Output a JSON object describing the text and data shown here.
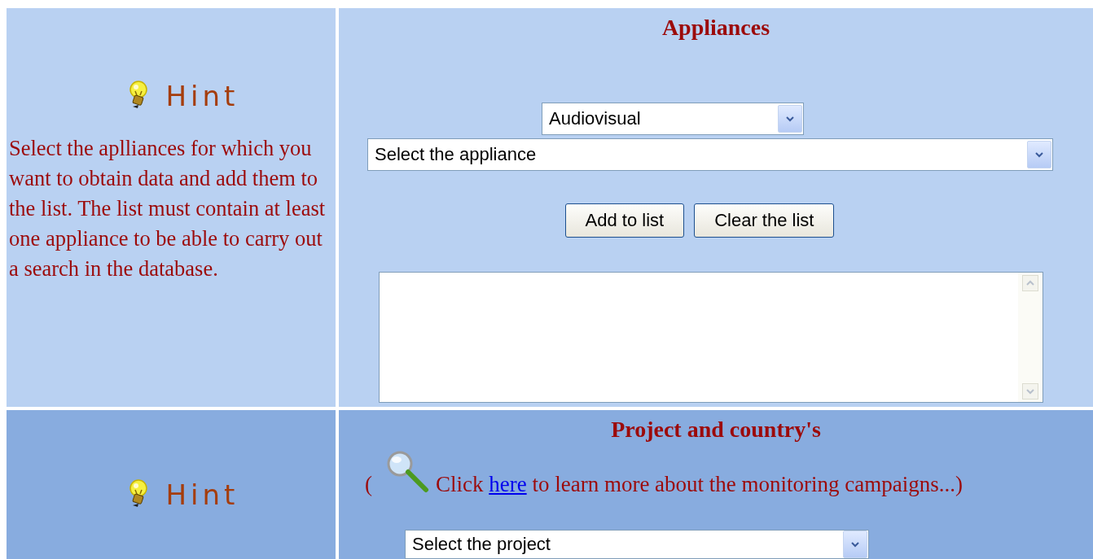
{
  "sections": [
    {
      "hint": {
        "label": "Hint",
        "text": "Select the aplliances for which you want to obtain data and add them to the list. The list must contain at least one appliance to be able to carry out a search in the database."
      },
      "title": "Appliances",
      "controls": [
        {
          "kind": "select",
          "value": "Audiovisual"
        },
        {
          "kind": "select",
          "value": "Select the appliance"
        },
        {
          "kind": "buttons",
          "buttons": [
            "Add to list",
            "Clear the list"
          ]
        },
        {
          "kind": "listbox"
        }
      ]
    },
    {
      "hint": {
        "label": "Hint"
      },
      "title": "Project and country's",
      "controls": [
        {
          "kind": "info",
          "open": "(",
          "before": "Click ",
          "link": "here",
          "after": " to learn more about the monitoring campaigns...)"
        },
        {
          "kind": "select",
          "value": "Select the project"
        }
      ]
    }
  ]
}
